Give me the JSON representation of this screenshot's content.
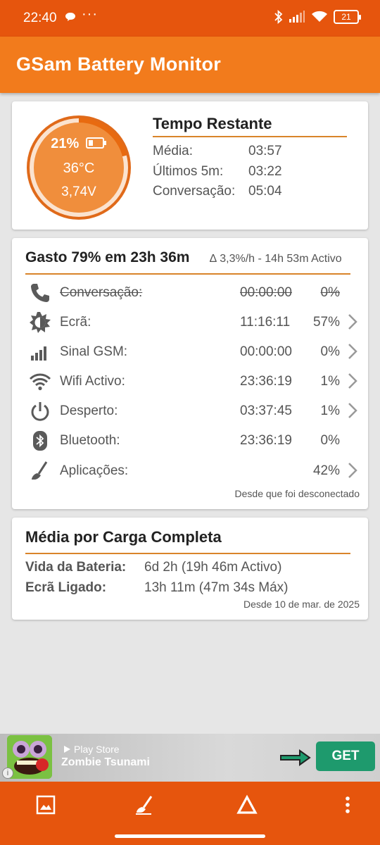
{
  "status_bar": {
    "time": "22:40",
    "more": "···",
    "battery": "21"
  },
  "app": {
    "title": "GSam Battery Monitor"
  },
  "battery_card": {
    "percent": "21%",
    "level": 0.21,
    "temperature": "36°C",
    "voltage": "3,74V",
    "title": "Tempo Restante",
    "rows": [
      {
        "label": "Média:",
        "value": "03:57"
      },
      {
        "label": "Últimos 5m:",
        "value": "03:22"
      },
      {
        "label": "Conversação:",
        "value": "05:04"
      }
    ]
  },
  "usage_card": {
    "title": "Gasto 79% em 23h 36m",
    "subtitle": "∆ 3,3%/h - 14h 53m Activo",
    "rows": [
      {
        "icon": "phone-icon",
        "label": "Conversação:",
        "time": "00:00:00",
        "percent": "0%",
        "struck": true,
        "chevron": false
      },
      {
        "icon": "screen-brightness-icon",
        "label": "Ecrã:",
        "time": "11:16:11",
        "percent": "57%",
        "struck": false,
        "chevron": true
      },
      {
        "icon": "signal-bars-icon",
        "label": "Sinal GSM:",
        "time": "00:00:00",
        "percent": "0%",
        "struck": false,
        "chevron": true
      },
      {
        "icon": "wifi-icon",
        "label": "Wifi Activo:",
        "time": "23:36:19",
        "percent": "1%",
        "struck": false,
        "chevron": true
      },
      {
        "icon": "power-icon",
        "label": "Desperto:",
        "time": "03:37:45",
        "percent": "1%",
        "struck": false,
        "chevron": true
      },
      {
        "icon": "bluetooth-icon",
        "label": "Bluetooth:",
        "time": "23:36:19",
        "percent": "0%",
        "struck": false,
        "chevron": false
      },
      {
        "icon": "apps-sweep-icon",
        "label": "Aplicações:",
        "time": "",
        "percent": "42%",
        "struck": false,
        "chevron": true
      }
    ],
    "footer": "Desde que foi desconectado"
  },
  "average_card": {
    "title": "Média por Carga Completa",
    "rows": [
      {
        "label": "Vida da Bateria:",
        "value": "6d 2h (19h 46m Activo)"
      },
      {
        "label": "Ecrã Ligado:",
        "value": "13h 11m (47m 34s Máx)"
      }
    ],
    "footer": "Desde 10 de mar. de 2025"
  },
  "ad": {
    "store": "Play Store",
    "app_name": "Zombie Tsunami",
    "cta": "GET",
    "info": "i"
  },
  "colors": {
    "primary": "#f27b1c",
    "primary_dark": "#e6550d",
    "accent_rule": "#d9842a",
    "gauge_fill": "#f08e3c",
    "cta_green": "#1e9a6d"
  }
}
